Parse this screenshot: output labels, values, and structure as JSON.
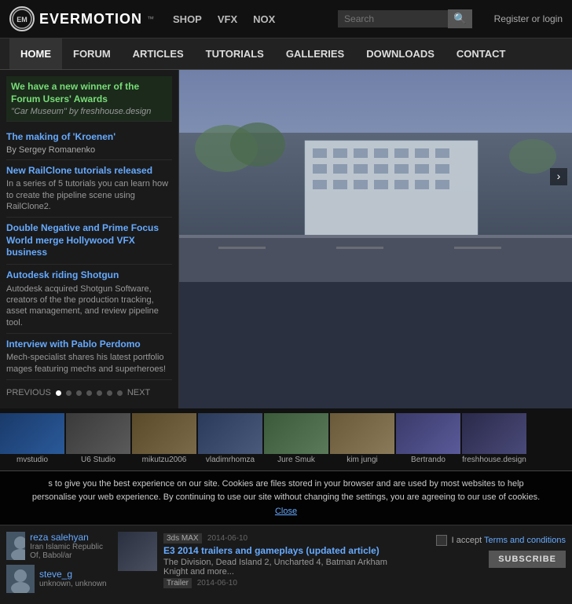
{
  "header": {
    "logo_text": "EVERMOTION",
    "logo_tm": "™",
    "top_nav": [
      {
        "label": "SHOP",
        "href": "#"
      },
      {
        "label": "VFX",
        "href": "#"
      },
      {
        "label": "NOX",
        "href": "#"
      }
    ],
    "search_placeholder": "Search",
    "register_label": "Register or login"
  },
  "main_nav": [
    {
      "label": "HOME",
      "active": true
    },
    {
      "label": "FORUM"
    },
    {
      "label": "ARTICLES"
    },
    {
      "label": "TUTORIALS"
    },
    {
      "label": "GALLERIES"
    },
    {
      "label": "DOWNLOADS"
    },
    {
      "label": "CONTACT"
    }
  ],
  "sidebar": {
    "forum_winner_title": "We have a new winner of the Forum Users' Awards",
    "forum_winner_sub": "\"Car Museum\" by freshhouse.design",
    "news": [
      {
        "title": "The making of 'Kroenen'",
        "sub": "By Sergey Romanenko"
      },
      {
        "title": "New RailClone tutorials released",
        "body": "In a series of 5 tutorials you can learn how to create the pipeline scene using RailClone2."
      },
      {
        "title": "Double Negative and Prime Focus World merge Hollywood VFX business"
      },
      {
        "title": "Autodesk riding Shotgun",
        "body": "Autodesk acquired Shotgun Software, creators of the the production tracking, asset management, and review pipeline tool."
      },
      {
        "title": "Interview with Pablo Perdomo",
        "body": "Mech-specialist shares his latest portfolio mages featuring mechs and superheroes!"
      }
    ],
    "prev_label": "PREVIOUS",
    "next_label": "NEXT",
    "dots": 7
  },
  "thumbnails": [
    {
      "label": "mvstudio",
      "color": "#1a3a6a"
    },
    {
      "label": "U6 Studio",
      "color": "#3a3a3a"
    },
    {
      "label": "mikutzu2006",
      "color": "#4a3a2a"
    },
    {
      "label": "vladimrhomza",
      "color": "#2a3a4a"
    },
    {
      "label": "Jure Smuk",
      "color": "#3a4a3a"
    },
    {
      "label": "kim jungi",
      "color": "#5a4a3a"
    },
    {
      "label": "Bertrando",
      "color": "#3a3a5a"
    },
    {
      "label": "freshhouse.design",
      "color": "#2a2a3a"
    }
  ],
  "cookie": {
    "text": "s to give you the best experience on our site. Cookies are files stored in your browser and are used by most websites to help personalise your web experience. By continuing to use our site without changing the settings, you are agreeing to our use of cookies.",
    "close_label": "Close"
  },
  "users": [
    {
      "name": "reza salehyan",
      "location": "Iran Islamic Republic Of, Babol/ar",
      "avatar_color": "#557"
    },
    {
      "name": "steve_g",
      "location": "unknown, unknown",
      "avatar_color": "#557"
    }
  ],
  "articles": [
    {
      "title": "E3 2014 trailers and gameplays (updated article)",
      "desc": "The Division, Dead Island 2, Uncharted 4, Batman Arkham Knight and more...",
      "tag": "Trailer",
      "date": "2014-06-10",
      "thumb_color": "#2a3040",
      "format_tag": "3ds MAX",
      "format_date": "2014-06-10"
    }
  ],
  "subscribe": {
    "checkbox_label": "I accept",
    "terms_label": "Terms and conditions",
    "button_label": "SUBSCRIBE"
  }
}
